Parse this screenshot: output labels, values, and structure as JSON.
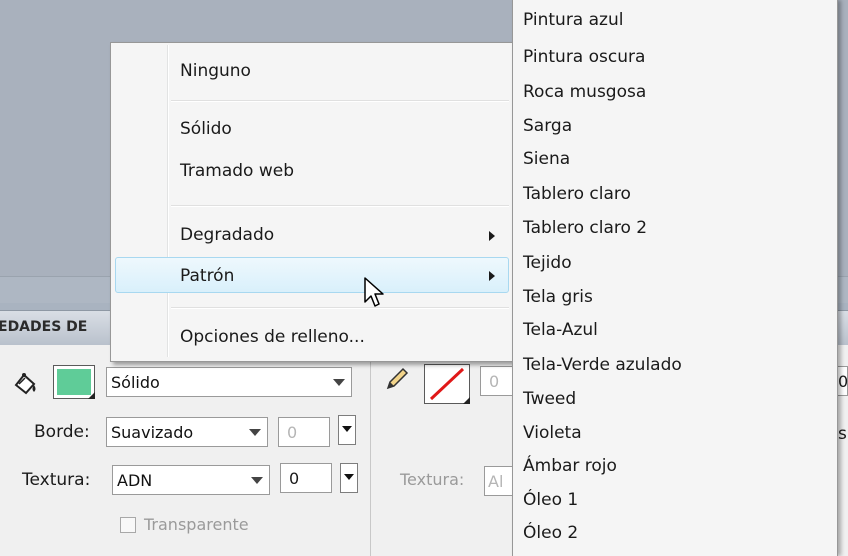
{
  "panel": {
    "header_title": "EDADES DE",
    "fill_style_value": "Sólido",
    "borde_label": "Borde:",
    "borde_value": "Suavizado",
    "borde_number": "0",
    "textura_label": "Textura:",
    "textura_value": "ADN",
    "textura_number": "0",
    "transparente_label": "Transparente",
    "stroke_number": "0",
    "right_textura_label": "Textura:",
    "right_textura_value": "Al",
    "far_right_1": "0",
    "far_right_2": "s",
    "colors": {
      "fill_swatch": "#5fcc98",
      "stroke_slash": "#e01818"
    }
  },
  "menu": {
    "items": [
      {
        "label": "Ninguno"
      },
      {
        "label": "Sólido"
      },
      {
        "label": "Tramado web"
      },
      {
        "label": "Degradado"
      },
      {
        "label": "Patrón"
      },
      {
        "label": "Opciones de relleno..."
      }
    ]
  },
  "submenu": {
    "items": [
      "Pintura azul",
      "Pintura oscura",
      "Roca musgosa",
      "Sarga",
      "Siena",
      "Tablero claro",
      "Tablero claro 2",
      "Tejido",
      "Tela gris",
      "Tela-Azul",
      "Tela-Verde azulado",
      "Tweed",
      "Violeta",
      "Ámbar rojo",
      "Óleo 1",
      "Óleo 2"
    ]
  },
  "icons": {
    "fill_bucket": "paint-bucket-icon",
    "pencil": "pencil-icon",
    "cursor": "mouse-pointer-icon",
    "submenu_arrow": "chevron-right-icon"
  }
}
